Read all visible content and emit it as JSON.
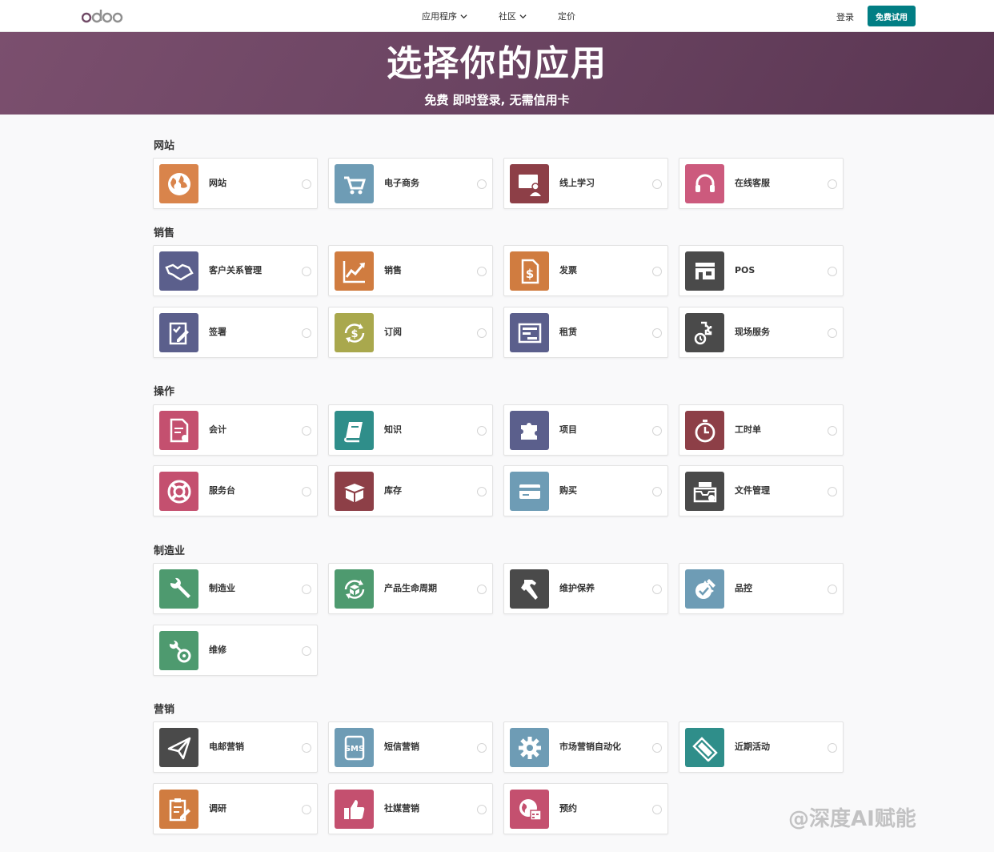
{
  "navbar": {
    "logo": "odoo",
    "menu": [
      {
        "label": "应用程序",
        "has_dropdown": true
      },
      {
        "label": "社区",
        "has_dropdown": true
      },
      {
        "label": "定价",
        "has_dropdown": false
      }
    ],
    "login": "登录",
    "trial": "免费试用"
  },
  "hero": {
    "title": "选择你的应用",
    "subtitle": "免费 即时登录, 无需信用卡"
  },
  "sections": [
    {
      "title": "网站",
      "apps": [
        {
          "label": "网站",
          "icon": "globe-icon",
          "color": "#d9844b"
        },
        {
          "label": "电子商务",
          "icon": "cart-icon",
          "color": "#6e9cb5"
        },
        {
          "label": "线上学习",
          "icon": "presenter-icon",
          "color": "#8d3f47"
        },
        {
          "label": "在线客服",
          "icon": "headset-icon",
          "color": "#cc5a7d"
        }
      ]
    },
    {
      "title": "销售",
      "apps": [
        {
          "label": "客户关系管理",
          "icon": "handshake-icon",
          "color": "#5b5f8c"
        },
        {
          "label": "销售",
          "icon": "chart-up-icon",
          "color": "#d07c40"
        },
        {
          "label": "发票",
          "icon": "invoice-icon",
          "color": "#d07c40"
        },
        {
          "label": "POS",
          "icon": "shop-icon",
          "color": "#4a4a4a"
        },
        {
          "label": "签署",
          "icon": "signature-icon",
          "color": "#5b5f8c"
        },
        {
          "label": "订阅",
          "icon": "subscription-icon",
          "color": "#a9a84d"
        },
        {
          "label": "租赁",
          "icon": "rental-icon",
          "color": "#5b5f8c"
        },
        {
          "label": "现场服务",
          "icon": "field-service-icon",
          "color": "#4a4a4a"
        }
      ]
    },
    {
      "title": "操作",
      "apps": [
        {
          "label": "会计",
          "icon": "accounting-icon",
          "color": "#c4506f"
        },
        {
          "label": "知识",
          "icon": "book-icon",
          "color": "#2f8e8a"
        },
        {
          "label": "项目",
          "icon": "puzzle-icon",
          "color": "#5b5f8c"
        },
        {
          "label": "工时单",
          "icon": "stopwatch-icon",
          "color": "#8d3f47"
        },
        {
          "label": "服务台",
          "icon": "lifebuoy-icon",
          "color": "#c4506f"
        },
        {
          "label": "库存",
          "icon": "box-icon",
          "color": "#8d3f47"
        },
        {
          "label": "购买",
          "icon": "card-icon",
          "color": "#6e9cb5"
        },
        {
          "label": "文件管理",
          "icon": "inbox-icon",
          "color": "#4a4a4a"
        }
      ]
    },
    {
      "title": "制造业",
      "apps": [
        {
          "label": "制造业",
          "icon": "wrench-icon",
          "color": "#4e9a6f"
        },
        {
          "label": "产品生命周期",
          "icon": "lifecycle-icon",
          "color": "#4e9a6f"
        },
        {
          "label": "维护保养",
          "icon": "hammer-icon",
          "color": "#4a4a4a"
        },
        {
          "label": "品控",
          "icon": "quality-icon",
          "color": "#6e9cb5"
        },
        {
          "label": "维修",
          "icon": "repair-icon",
          "color": "#4e9a6f"
        }
      ]
    },
    {
      "title": "营销",
      "apps": [
        {
          "label": "电邮营销",
          "icon": "paper-plane-icon",
          "color": "#4a4a4a"
        },
        {
          "label": "短信营销",
          "icon": "sms-icon",
          "color": "#6e9cb5"
        },
        {
          "label": "市场营销自动化",
          "icon": "gear-icon",
          "color": "#6e9cb5"
        },
        {
          "label": "近期活动",
          "icon": "ticket-icon",
          "color": "#2f8e8a"
        },
        {
          "label": "调研",
          "icon": "survey-icon",
          "color": "#d07c40"
        },
        {
          "label": "社媒营销",
          "icon": "thumbs-up-icon",
          "color": "#c4506f"
        },
        {
          "label": "预约",
          "icon": "appointment-icon",
          "color": "#c4506f"
        }
      ]
    }
  ],
  "watermark": "@深度AI赋能"
}
